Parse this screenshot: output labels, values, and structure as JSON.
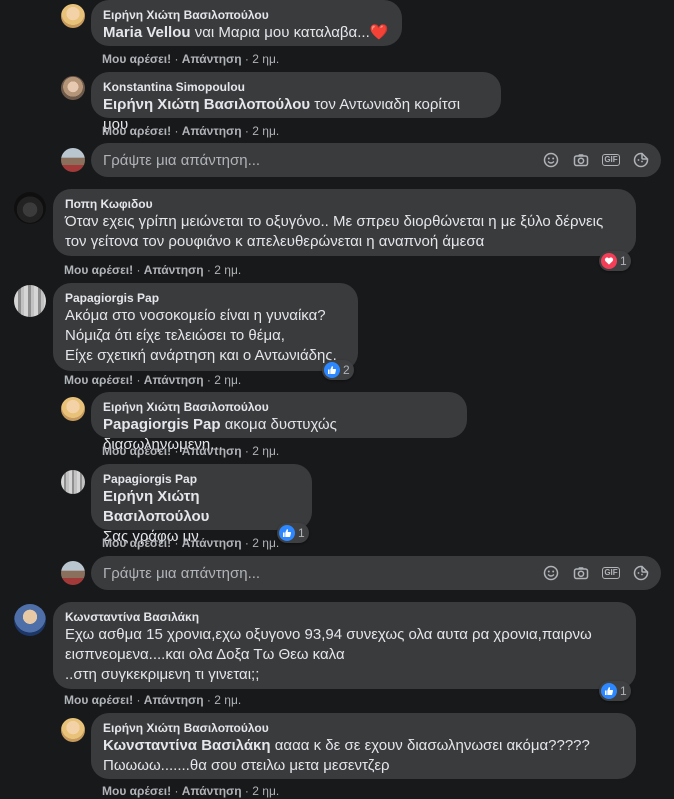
{
  "actions": {
    "like": "Μου αρέσει!",
    "reply": "Απάντηση",
    "time": "2 ημ.",
    "sep": "·"
  },
  "reply_placeholder": "Γράψτε μια απάντηση...",
  "comments": [
    {
      "author": "Ειρήνη Χιώτη Βασιλοπούλου",
      "mention": "Maria Vellou",
      "text": " ναι Μαρια μου καταλαβα...",
      "emoji": "❤️"
    },
    {
      "author": "Konstantina Simopoulou",
      "mention": "Ειρήνη Χιώτη Βασιλοπούλου",
      "text": " τον Αντωνιαδη κορίτσι μου"
    },
    {
      "author": "Ποπη Κωφιδου",
      "line1": "Όταν εχεις γρίπη μειώνεται το οξυγόνο.. Με σπρευ διορθώνεται η με ξύλο δέρνεις",
      "line2": "τον γείτονα τον ρουφιάνο κ απελευθερώνεται η αναπνοή άμεσα",
      "reaction": {
        "type": "love",
        "count": "1"
      }
    },
    {
      "author": "Papagiorgis Pap",
      "line1": "Ακόμα στο νοσοκομείο είναι η γυναίκα?",
      "line2": "Νόμιζα ότι είχε τελειώσει το θέμα,",
      "line3": "Είχε σχετική ανάρτηση και ο Αντωνιάδης.",
      "reaction": {
        "type": "like",
        "count": "2"
      }
    },
    {
      "author": "Ειρήνη Χιώτη Βασιλοπούλου",
      "mention": "Papagiorgis Pap",
      "text": " ακομα δυστυχώς διασωληνωμενη..."
    },
    {
      "author": "Papagiorgis Pap",
      "mention": "Ειρήνη Χιώτη Βασιλοπούλου",
      "line2": "Σας γράφω μν",
      "reaction": {
        "type": "like",
        "count": "1"
      }
    },
    {
      "author": "Κωνσταντίνα Βασιλάκη",
      "line1": "Εχω ασθμα 15 χρονια,εχω οξυγονο 93,94 συνεχως ολα αυτα ρα χρονια,παιρνω",
      "line2": "εισπνεομενα....και ολα Δοξα Τω Θεω καλα",
      "line3": "..στη συγκεκριμενη τι γινεται;;",
      "reaction": {
        "type": "like",
        "count": "1"
      }
    },
    {
      "author": "Ειρήνη Χιώτη Βασιλοπούλου",
      "mention": "Κωνσταντίνα Βασιλάκη",
      "text": " αααα κ δε σε εχουν διασωληνωσει ακόμα?????",
      "line2": "Πωωωω.......θα σου στειλω μετα μεσεντζερ"
    }
  ],
  "colors": {
    "like": "#2d88ff",
    "love": "#f33e58",
    "bubble": "#3a3b3c",
    "bg": "#18191a"
  }
}
